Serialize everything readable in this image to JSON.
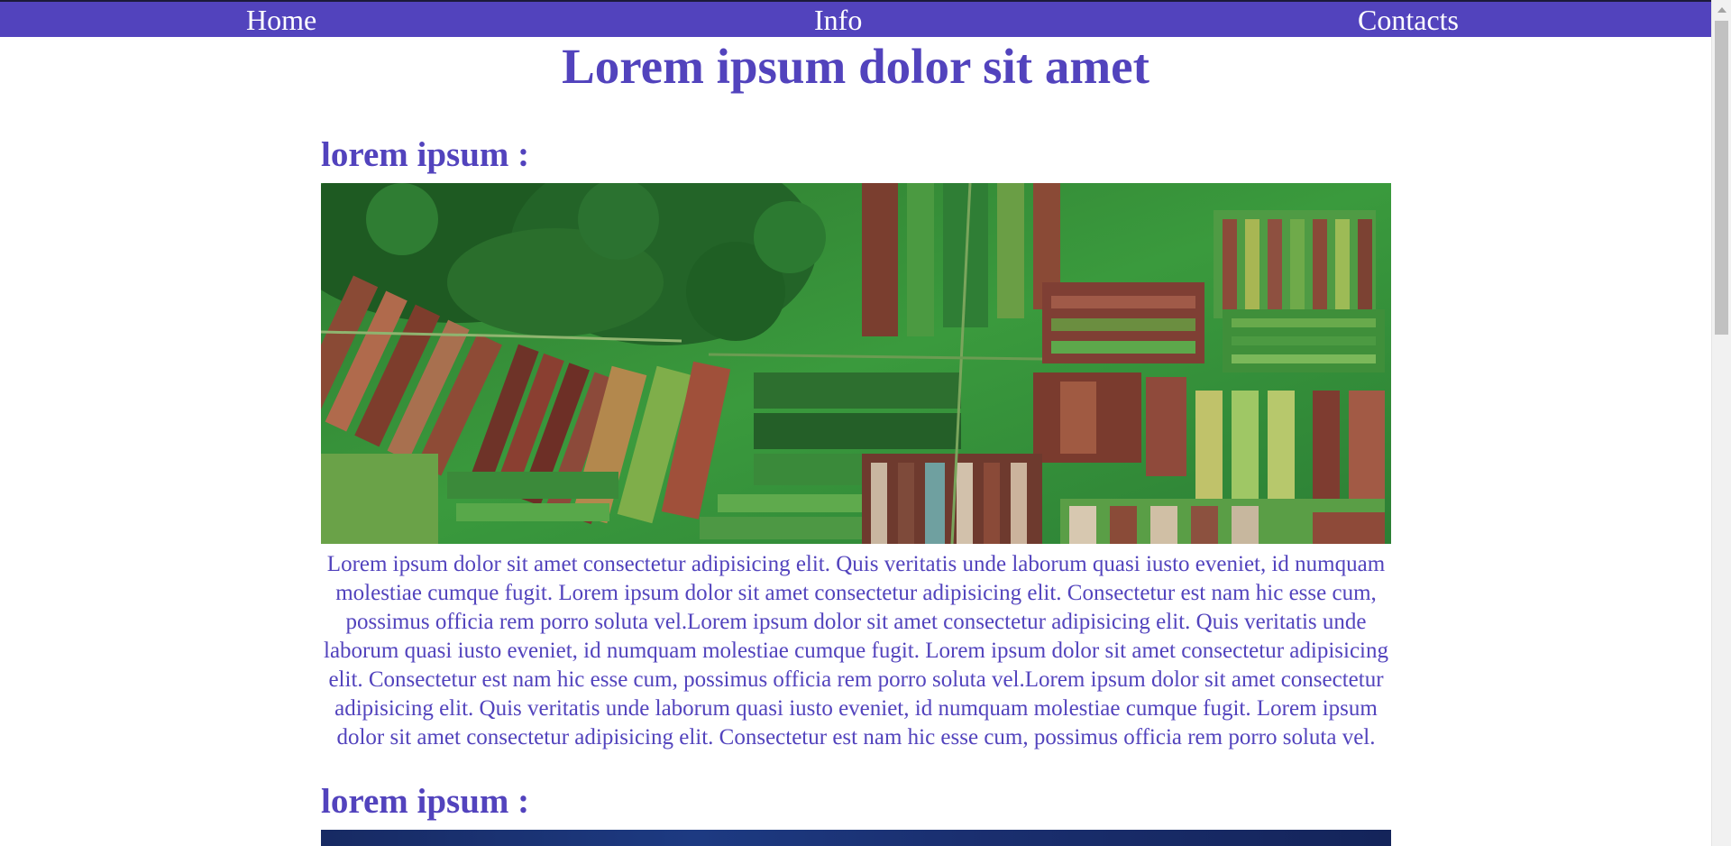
{
  "nav": {
    "home_label": "Home",
    "info_label": "Info",
    "contacts_label": "Contacts",
    "bar_color": "#5243bd"
  },
  "page": {
    "title": "Lorem ipsum dolor sit amet",
    "accent_color": "#5243bd"
  },
  "sections": [
    {
      "heading": "lorem ipsum :",
      "image": "aerial-farm-fields-image",
      "text": "Lorem ipsum dolor sit amet consectetur adipisicing elit. Quis veritatis unde laborum quasi iusto eveniet, id numquam molestiae cumque fugit. Lorem ipsum dolor sit amet consectetur adipisicing elit. Consectetur est nam hic esse cum, possimus officia rem porro soluta vel.Lorem ipsum dolor sit amet consectetur adipisicing elit. Quis veritatis unde laborum quasi iusto eveniet, id numquam molestiae cumque fugit. Lorem ipsum dolor sit amet consectetur adipisicing elit. Consectetur est nam hic esse cum, possimus officia rem porro soluta vel.Lorem ipsum dolor sit amet consectetur adipisicing elit. Quis veritatis unde laborum quasi iusto eveniet, id numquam molestiae cumque fugit. Lorem ipsum dolor sit amet consectetur adipisicing elit. Consectetur est nam hic esse cum, possimus officia rem porro soluta vel."
    },
    {
      "heading": "lorem ipsum :",
      "image": "dark-blue-image"
    }
  ]
}
